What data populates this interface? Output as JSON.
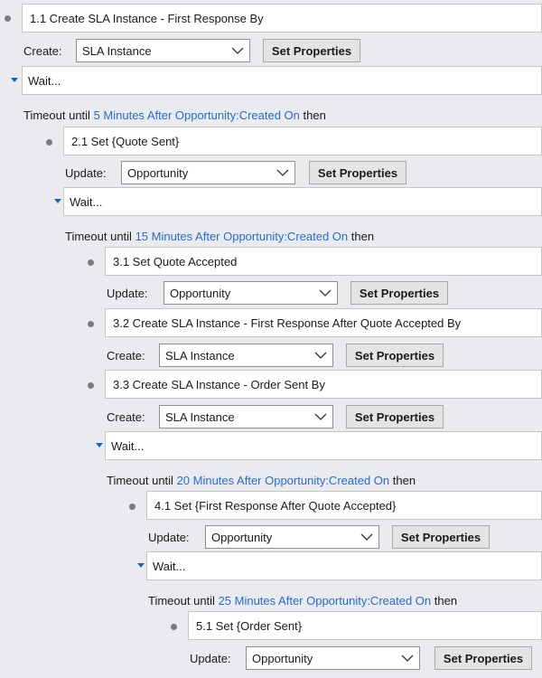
{
  "steps": {
    "s1_1": {
      "title": "1.1 Create SLA Instance - First Response By",
      "action_label": "Create:",
      "entity": "SLA Instance",
      "button": "Set Properties"
    },
    "wait1": {
      "label": "Wait...",
      "timeout_prefix": "Timeout until",
      "timeout_link": "5 Minutes After Opportunity:Created On",
      "timeout_suffix": "then"
    },
    "s2_1": {
      "title": "2.1 Set {Quote Sent}",
      "action_label": "Update:",
      "entity": "Opportunity",
      "button": "Set Properties"
    },
    "wait2": {
      "label": "Wait...",
      "timeout_prefix": "Timeout until",
      "timeout_link": "15 Minutes After Opportunity:Created On",
      "timeout_suffix": "then"
    },
    "s3_1": {
      "title": "3.1 Set Quote Accepted",
      "action_label": "Update:",
      "entity": "Opportunity",
      "button": "Set Properties"
    },
    "s3_2": {
      "title": "3.2 Create SLA Instance - First Response After Quote Accepted By",
      "action_label": "Create:",
      "entity": "SLA Instance",
      "button": "Set Properties"
    },
    "s3_3": {
      "title": "3.3 Create SLA Instance - Order Sent By",
      "action_label": "Create:",
      "entity": "SLA Instance",
      "button": "Set Properties"
    },
    "wait3": {
      "label": "Wait...",
      "timeout_prefix": "Timeout until",
      "timeout_link": "20 Minutes After Opportunity:Created On",
      "timeout_suffix": "then"
    },
    "s4_1": {
      "title": "4.1 Set {First Response After Quote Accepted}",
      "action_label": "Update:",
      "entity": "Opportunity",
      "button": "Set Properties"
    },
    "wait4": {
      "label": "Wait...",
      "timeout_prefix": "Timeout until",
      "timeout_link": "25 Minutes After Opportunity:Created On",
      "timeout_suffix": "then"
    },
    "s5_1": {
      "title": "5.1 Set {Order Sent}",
      "action_label": "Update:",
      "entity": "Opportunity",
      "button": "Set Properties"
    }
  },
  "icons": {
    "step_bullet": "bullet-dot-icon",
    "collapse": "collapse-triangle-icon",
    "dropdown": "chevron-down-icon"
  },
  "colors": {
    "link": "#2a6bd2",
    "triangle": "#1a63c6",
    "background": "#e9ebee"
  }
}
